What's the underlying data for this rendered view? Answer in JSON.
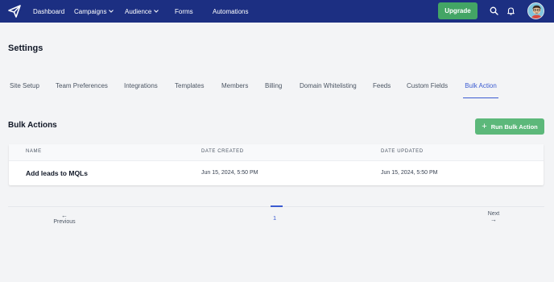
{
  "nav": {
    "dashboard": "Dashboard",
    "campaigns": "Campaigns",
    "audience": "Audience",
    "forms": "Forms",
    "automations": "Automations",
    "upgrade": "Upgrade",
    "icons": [
      "paper-plane-logo-icon",
      "search-icon",
      "bell-icon",
      "chevron-down-icon"
    ]
  },
  "page": {
    "title": "Settings"
  },
  "tabs": [
    {
      "label": "Site Setup",
      "active": false
    },
    {
      "label": "Team Preferences",
      "active": false
    },
    {
      "label": "Integrations",
      "active": false
    },
    {
      "label": "Templates",
      "active": false
    },
    {
      "label": "Members",
      "active": false
    },
    {
      "label": "Billing",
      "active": false
    },
    {
      "label": "Domain Whitelisting",
      "active": false
    },
    {
      "label": "Feeds",
      "active": false
    },
    {
      "label": "Custom Fields",
      "active": false
    },
    {
      "label": "Bulk Action",
      "active": true
    }
  ],
  "bulk": {
    "title": "Bulk Actions",
    "run_button": "Run Bulk Action",
    "columns": {
      "name": "NAME",
      "created": "DATE CREATED",
      "updated": "DATE UPDATED"
    },
    "rows": [
      {
        "name": "Add leads to MQLs",
        "created": "Jun 15, 2024, 5:50 PM",
        "updated": "Jun 15, 2024, 5:50 PM"
      }
    ]
  },
  "pagination": {
    "previous": "Previous",
    "next": "Next",
    "current_page": "1"
  },
  "colors": {
    "nav_bg": "#1c2f82",
    "accent": "#3b5bd1",
    "upgrade": "#43a565",
    "run_button": "#5cb87a"
  }
}
